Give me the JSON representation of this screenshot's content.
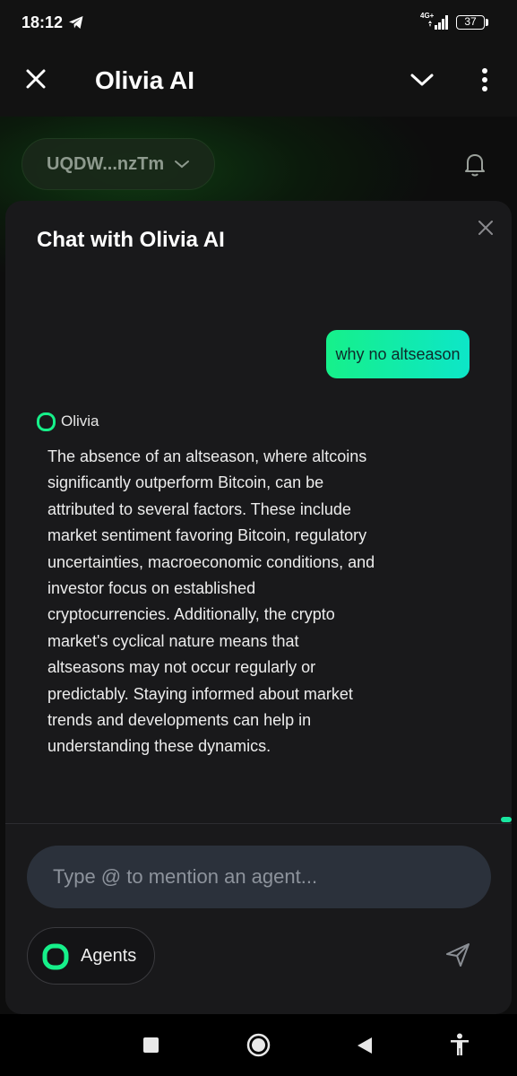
{
  "status_bar": {
    "time": "18:12",
    "network_type": "4G+",
    "battery_level": "37",
    "icons": [
      "telegram-icon",
      "signal-icon",
      "battery-icon"
    ]
  },
  "app_bar": {
    "title": "Olivia AI",
    "icons": [
      "close-icon",
      "chevron-down-icon",
      "more-vertical-icon"
    ]
  },
  "wallet": {
    "address": "UQDW...nzTm",
    "icons": [
      "chevron-down-icon",
      "bell-icon"
    ]
  },
  "chat": {
    "title": "Chat with Olivia AI",
    "user_message": "why no altseason",
    "assistant_name": "Olivia",
    "assistant_lines": [
      "The absence of an altseason, where altcoins",
      "significantly outperform Bitcoin, can be",
      "attributed to several factors. These include",
      "market sentiment favoring Bitcoin, regulatory",
      "uncertainties, macroeconomic conditions, and",
      "investor focus on established",
      "cryptocurrencies. Additionally, the crypto",
      "market's cyclical nature means that",
      "altseasons may not occur regularly or",
      "predictably. Staying informed about market",
      "trends and developments can help in",
      "understanding these dynamics."
    ]
  },
  "composer": {
    "placeholder": "Type @ to mention an agent...",
    "agents_label": "Agents",
    "icons": [
      "agents-logo-icon",
      "send-icon"
    ]
  },
  "nav_bar": {
    "icons": [
      "recents-icon",
      "home-icon",
      "back-icon",
      "accessibility-icon"
    ]
  },
  "colors": {
    "accent_green": "#16f08a",
    "accent_teal": "#0de6c8",
    "panel_bg": "#19191b",
    "input_bg": "#2b313b"
  }
}
